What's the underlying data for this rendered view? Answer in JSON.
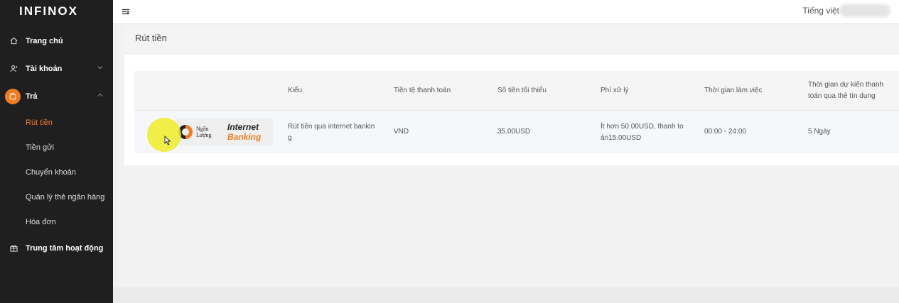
{
  "brand": "INFINOX",
  "sidebar": {
    "items": [
      {
        "label": "Trang chủ",
        "icon": "home-icon"
      },
      {
        "label": "Tài khoản",
        "icon": "user-icon"
      },
      {
        "label": "Trả",
        "icon": "wallet-icon",
        "expanded": true
      },
      {
        "label": "Trung tâm hoạt động",
        "icon": "gift-icon"
      }
    ],
    "sub_items": [
      {
        "label": "Rút tiền",
        "active": true
      },
      {
        "label": "Tiền gửi"
      },
      {
        "label": "Chuyển khoản"
      },
      {
        "label": "Quản lý thẻ ngân hàng"
      },
      {
        "label": "Hóa đơn"
      }
    ]
  },
  "topbar": {
    "language": "Tiếng việt"
  },
  "page": {
    "title": "Rút tiền"
  },
  "table": {
    "headers": [
      "Kiểu",
      "Tiền tệ thanh toán",
      "Số tiền tối thiểu",
      "Phí xử lý",
      "Thời gian làm việc",
      "Thời gian dự kiến thanh toán qua thẻ tín dụng"
    ],
    "rows": [
      {
        "logo": {
          "name_line1": "Ngân",
          "name_line2": "Lượng",
          "brand_line1": "Internet",
          "brand_line2": "Banking"
        },
        "type": "Rút tiền qua internet bankin g",
        "currency": "VND",
        "min_amount": "35.00USD",
        "fee": "Ít hơn 50.00USD, thanh to án15.00USD",
        "working_time": "00:00 - 24:00",
        "expected_time": "5 Ngày"
      }
    ]
  },
  "colors": {
    "sidebar_bg": "#1f1f1f",
    "accent": "#f07c22",
    "highlight": "#f0ec28"
  }
}
